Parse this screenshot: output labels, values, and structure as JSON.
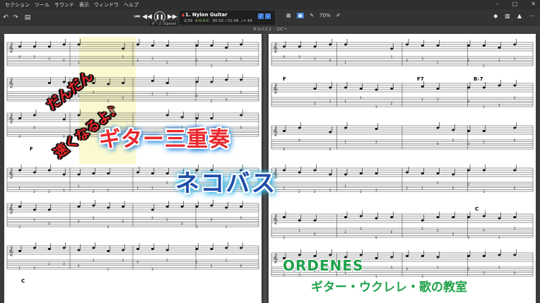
{
  "menu": [
    "セクション",
    "ツール",
    "サウンド",
    "表示",
    "ウィンドウ",
    "ヘルプ"
  ],
  "transport": {
    "tooltip": "ポーズ (Space)"
  },
  "track": {
    "name": "1. Nylon Guitar",
    "bar": "2/39",
    "sig": "4:0:4.0",
    "time": "00:02 / 01:48",
    "tempo": "♩= 84"
  },
  "zoom": "70%",
  "document_tab": "ネコバス２ - コピー",
  "score": {
    "chords": [
      "F",
      "C",
      "F",
      "F7",
      "B♭7",
      "C"
    ]
  },
  "overlay": {
    "sub_line1": "だんだん",
    "sub_line2": "速くなるよ♪",
    "title1": "ギター三重奏",
    "title2": "ネコバス"
  },
  "brand": {
    "name": "ORDENES",
    "tagline": "ギター・ウクレレ・歌の教室"
  },
  "colors": {
    "title_red": "#e8262b",
    "title_blue": "#1f4fa8",
    "brand_green": "#1fa14a",
    "accent": "#3d7bd6"
  }
}
